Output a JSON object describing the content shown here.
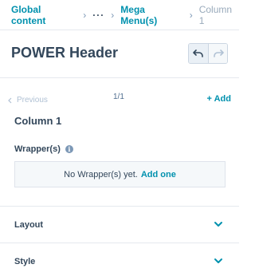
{
  "breadcrumb": {
    "root": "Global content",
    "more": "···",
    "parent": "Mega Menu(s)",
    "current": "Column 1",
    "separator": "›"
  },
  "header": {
    "title": "POWER Header",
    "undo_icon": "undo-icon",
    "redo_icon": "redo-icon"
  },
  "pager": {
    "previous_label": "Previous",
    "count": "1/1",
    "add_label": "+ Add"
  },
  "item": {
    "title": "Column 1",
    "wrapper_label": "Wrapper(s)",
    "empty_text": "No Wrapper(s) yet.",
    "empty_action": "Add one"
  },
  "sections": [
    {
      "label": "Layout"
    },
    {
      "label": "Style"
    }
  ],
  "colors": {
    "accent": "#0091ae",
    "text": "#33475b",
    "muted": "#99aabb"
  }
}
